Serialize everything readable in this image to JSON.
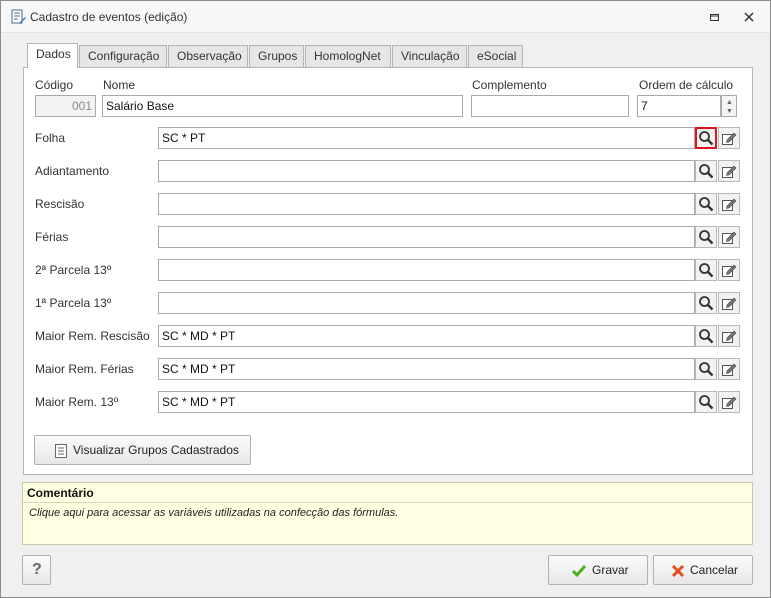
{
  "window": {
    "title": "Cadastro de eventos (edição)",
    "icons": {
      "app": "form-edit-icon",
      "restore": "restore-icon",
      "close": "close-icon"
    }
  },
  "tabs": [
    {
      "label": "Dados",
      "active": true
    },
    {
      "label": "Configuração",
      "active": false
    },
    {
      "label": "Observação",
      "active": false
    },
    {
      "label": "Grupos",
      "active": false
    },
    {
      "label": "HomologNet",
      "active": false
    },
    {
      "label": "Vinculação",
      "active": false
    },
    {
      "label": "eSocial",
      "active": false
    }
  ],
  "header_fields": {
    "codigo_label": "Código",
    "codigo_value": "001",
    "nome_label": "Nome",
    "nome_value": "Salário Base",
    "complemento_label": "Complemento",
    "complemento_value": "",
    "ordem_label": "Ordem de cálculo",
    "ordem_value": "7"
  },
  "formula_rows": [
    {
      "label": "Folha",
      "value": "SC * PT"
    },
    {
      "label": "Adiantamento",
      "value": ""
    },
    {
      "label": "Rescisão",
      "value": ""
    },
    {
      "label": "Férias",
      "value": ""
    },
    {
      "label": "2ª Parcela 13º",
      "value": ""
    },
    {
      "label": "1ª Parcela 13º",
      "value": ""
    },
    {
      "label": "Maior Rem. Rescisão",
      "value": "SC * MD * PT"
    },
    {
      "label": "Maior Rem. Férias",
      "value": "SC * MD * PT"
    },
    {
      "label": "Maior Rem. 13º",
      "value": "SC * MD * PT"
    }
  ],
  "row_icons": {
    "search": "magnifier-icon",
    "edit": "edit-pencil-icon"
  },
  "buttons": {
    "visualizar": "Visualizar Grupos Cadastrados",
    "help": "?",
    "save": "Gravar",
    "cancel": "Cancelar"
  },
  "comment": {
    "title": "Comentário",
    "text": "Clique aqui para acessar as variáveis utilizadas na confecção das fórmulas."
  },
  "colors": {
    "highlight": "#e0141e",
    "comment_bg": "#ffffe1",
    "save_check": "#4caf1e",
    "cancel_x": "#e0501e"
  }
}
